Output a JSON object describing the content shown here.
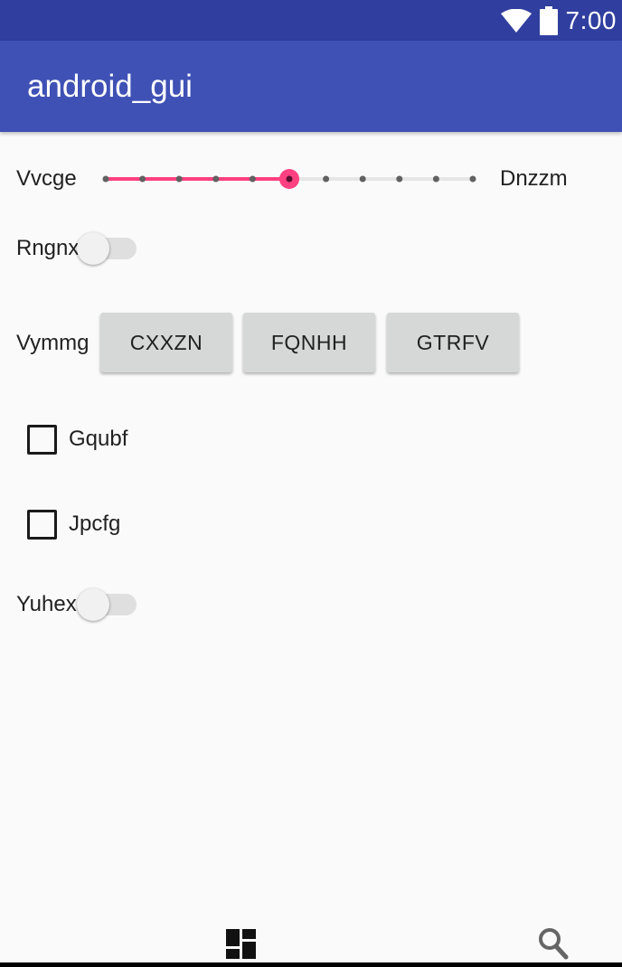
{
  "status_bar": {
    "time": "7:00",
    "icons": [
      "wifi-icon",
      "battery-icon"
    ],
    "background": "#303f9f"
  },
  "app_bar": {
    "title": "android_gui",
    "background": "#3f51b5"
  },
  "slider": {
    "left_label": "Vvcge",
    "right_label": "Dnzzm",
    "steps": 11,
    "value_index": 5,
    "accent": "#ff4081"
  },
  "switch_1": {
    "label": "Rngnx",
    "checked": false
  },
  "button_group": {
    "label": "Vymmg",
    "buttons": [
      "CXXZN",
      "FQNHH",
      "GTRFV"
    ]
  },
  "checkbox_1": {
    "label": "Gqubf",
    "checked": false
  },
  "checkbox_2": {
    "label": "Jpcfg",
    "checked": false
  },
  "switch_2": {
    "label": "Yuhex",
    "checked": false
  },
  "bottom_nav": {
    "icons": [
      "dashboard-icon",
      "search-icon"
    ]
  }
}
